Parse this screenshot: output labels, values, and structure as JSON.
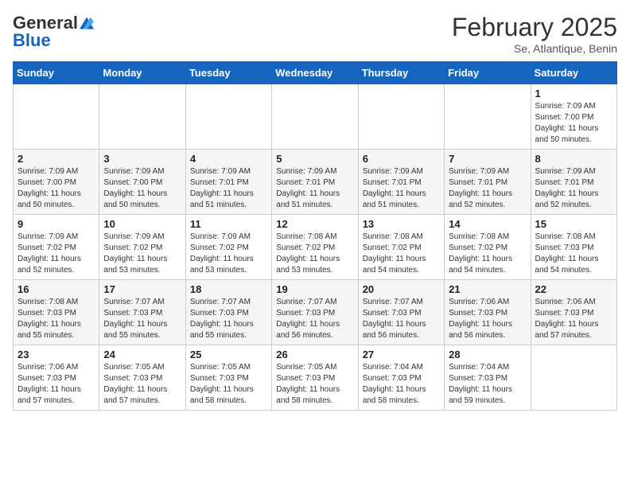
{
  "header": {
    "logo_general": "General",
    "logo_blue": "Blue",
    "month_title": "February 2025",
    "subtitle": "Se, Atlantique, Benin"
  },
  "weekdays": [
    "Sunday",
    "Monday",
    "Tuesday",
    "Wednesday",
    "Thursday",
    "Friday",
    "Saturday"
  ],
  "weeks": [
    [
      {
        "day": "",
        "info": ""
      },
      {
        "day": "",
        "info": ""
      },
      {
        "day": "",
        "info": ""
      },
      {
        "day": "",
        "info": ""
      },
      {
        "day": "",
        "info": ""
      },
      {
        "day": "",
        "info": ""
      },
      {
        "day": "1",
        "info": "Sunrise: 7:09 AM\nSunset: 7:00 PM\nDaylight: 11 hours\nand 50 minutes."
      }
    ],
    [
      {
        "day": "2",
        "info": "Sunrise: 7:09 AM\nSunset: 7:00 PM\nDaylight: 11 hours\nand 50 minutes."
      },
      {
        "day": "3",
        "info": "Sunrise: 7:09 AM\nSunset: 7:00 PM\nDaylight: 11 hours\nand 50 minutes."
      },
      {
        "day": "4",
        "info": "Sunrise: 7:09 AM\nSunset: 7:01 PM\nDaylight: 11 hours\nand 51 minutes."
      },
      {
        "day": "5",
        "info": "Sunrise: 7:09 AM\nSunset: 7:01 PM\nDaylight: 11 hours\nand 51 minutes."
      },
      {
        "day": "6",
        "info": "Sunrise: 7:09 AM\nSunset: 7:01 PM\nDaylight: 11 hours\nand 51 minutes."
      },
      {
        "day": "7",
        "info": "Sunrise: 7:09 AM\nSunset: 7:01 PM\nDaylight: 11 hours\nand 52 minutes."
      },
      {
        "day": "8",
        "info": "Sunrise: 7:09 AM\nSunset: 7:01 PM\nDaylight: 11 hours\nand 52 minutes."
      }
    ],
    [
      {
        "day": "9",
        "info": "Sunrise: 7:09 AM\nSunset: 7:02 PM\nDaylight: 11 hours\nand 52 minutes."
      },
      {
        "day": "10",
        "info": "Sunrise: 7:09 AM\nSunset: 7:02 PM\nDaylight: 11 hours\nand 53 minutes."
      },
      {
        "day": "11",
        "info": "Sunrise: 7:09 AM\nSunset: 7:02 PM\nDaylight: 11 hours\nand 53 minutes."
      },
      {
        "day": "12",
        "info": "Sunrise: 7:08 AM\nSunset: 7:02 PM\nDaylight: 11 hours\nand 53 minutes."
      },
      {
        "day": "13",
        "info": "Sunrise: 7:08 AM\nSunset: 7:02 PM\nDaylight: 11 hours\nand 54 minutes."
      },
      {
        "day": "14",
        "info": "Sunrise: 7:08 AM\nSunset: 7:02 PM\nDaylight: 11 hours\nand 54 minutes."
      },
      {
        "day": "15",
        "info": "Sunrise: 7:08 AM\nSunset: 7:03 PM\nDaylight: 11 hours\nand 54 minutes."
      }
    ],
    [
      {
        "day": "16",
        "info": "Sunrise: 7:08 AM\nSunset: 7:03 PM\nDaylight: 11 hours\nand 55 minutes."
      },
      {
        "day": "17",
        "info": "Sunrise: 7:07 AM\nSunset: 7:03 PM\nDaylight: 11 hours\nand 55 minutes."
      },
      {
        "day": "18",
        "info": "Sunrise: 7:07 AM\nSunset: 7:03 PM\nDaylight: 11 hours\nand 55 minutes."
      },
      {
        "day": "19",
        "info": "Sunrise: 7:07 AM\nSunset: 7:03 PM\nDaylight: 11 hours\nand 56 minutes."
      },
      {
        "day": "20",
        "info": "Sunrise: 7:07 AM\nSunset: 7:03 PM\nDaylight: 11 hours\nand 56 minutes."
      },
      {
        "day": "21",
        "info": "Sunrise: 7:06 AM\nSunset: 7:03 PM\nDaylight: 11 hours\nand 56 minutes."
      },
      {
        "day": "22",
        "info": "Sunrise: 7:06 AM\nSunset: 7:03 PM\nDaylight: 11 hours\nand 57 minutes."
      }
    ],
    [
      {
        "day": "23",
        "info": "Sunrise: 7:06 AM\nSunset: 7:03 PM\nDaylight: 11 hours\nand 57 minutes."
      },
      {
        "day": "24",
        "info": "Sunrise: 7:05 AM\nSunset: 7:03 PM\nDaylight: 11 hours\nand 57 minutes."
      },
      {
        "day": "25",
        "info": "Sunrise: 7:05 AM\nSunset: 7:03 PM\nDaylight: 11 hours\nand 58 minutes."
      },
      {
        "day": "26",
        "info": "Sunrise: 7:05 AM\nSunset: 7:03 PM\nDaylight: 11 hours\nand 58 minutes."
      },
      {
        "day": "27",
        "info": "Sunrise: 7:04 AM\nSunset: 7:03 PM\nDaylight: 11 hours\nand 58 minutes."
      },
      {
        "day": "28",
        "info": "Sunrise: 7:04 AM\nSunset: 7:03 PM\nDaylight: 11 hours\nand 59 minutes."
      },
      {
        "day": "",
        "info": ""
      }
    ]
  ]
}
